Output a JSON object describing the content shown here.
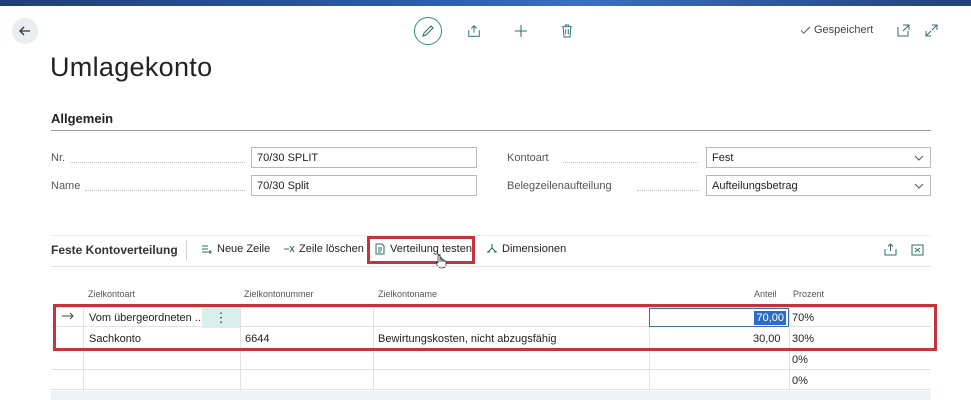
{
  "header": {
    "saved_label": "Gespeichert"
  },
  "page": {
    "title": "Umlagekonto"
  },
  "general": {
    "section_title": "Allgemein",
    "no_label": "Nr.",
    "no_value": "70/30 SPLIT",
    "name_label": "Name",
    "name_value": "70/30 Split",
    "account_type_label": "Kontoart",
    "account_type_value": "Fest",
    "line_split_label": "Belegzeilenaufteilung",
    "line_split_value": "Aufteilungsbetrag"
  },
  "distribution": {
    "title": "Feste Kontoverteilung",
    "toolbar": {
      "new_line": "Neue Zeile",
      "delete_line": "Zeile löschen",
      "test_distribution": "Verteilung testen",
      "dimensions": "Dimensionen"
    },
    "columns": {
      "target_type": "Zielkontoart",
      "target_no": "Zielkontonummer",
      "target_name": "Zielkontoname",
      "share": "Anteil",
      "percent": "Prozent"
    },
    "rows": [
      {
        "target_type": "Vom übergeordneten ...",
        "target_no": "",
        "target_name": "",
        "share": "70,00",
        "percent": "70%"
      },
      {
        "target_type": "Sachkonto",
        "target_no": "6644",
        "target_name": "Bewirtungskosten, nicht abzugsfähig",
        "share": "30,00",
        "percent": "30%"
      },
      {
        "target_type": "",
        "target_no": "",
        "target_name": "",
        "share": "",
        "percent": "0%"
      },
      {
        "target_type": "",
        "target_no": "",
        "target_name": "",
        "share": "",
        "percent": "0%"
      }
    ]
  },
  "colors": {
    "accent": "#3a8a80",
    "highlight": "#c8323a",
    "selection": "#2a6dc4"
  }
}
